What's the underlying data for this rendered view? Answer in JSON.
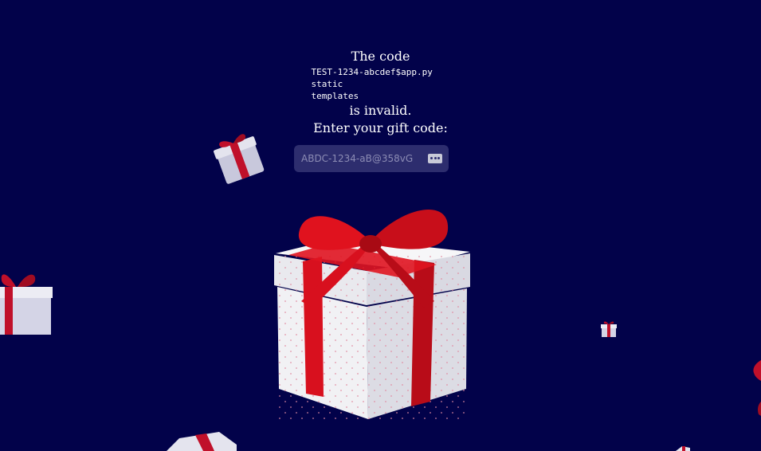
{
  "page": {
    "background": "#02024a"
  },
  "message": {
    "line1": "The code",
    "code_lines": [
      "TEST-1234-abcdef$app.py",
      "static",
      "templates"
    ],
    "line2": "is invalid.",
    "prompt": "Enter your gift code:"
  },
  "gift_input": {
    "placeholder": "ABDC-1234-aB@358vG",
    "value": "",
    "icon": "password-dots-icon"
  },
  "decorations": {
    "main_gift": "gift-box-icon",
    "small_gifts": "gift-box-icon",
    "ribbon_color": "#d8101e",
    "box_color": "#f4f4f6"
  }
}
